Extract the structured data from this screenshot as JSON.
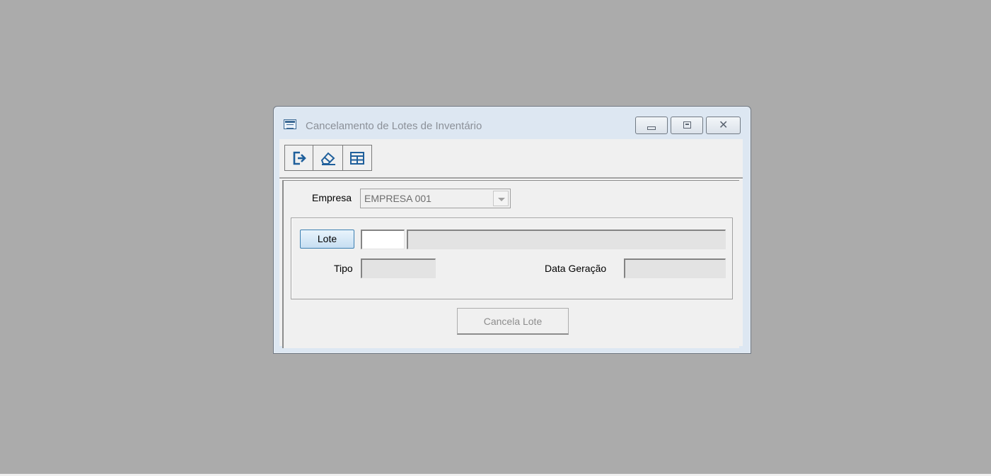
{
  "window": {
    "title": "Cancelamento de Lotes de Inventário"
  },
  "toolbar": {
    "buttons": [
      {
        "name": "exit",
        "icon": "exit-icon"
      },
      {
        "name": "clear",
        "icon": "eraser-icon"
      },
      {
        "name": "grid",
        "icon": "table-icon"
      }
    ]
  },
  "form": {
    "empresa_label": "Empresa",
    "empresa_value": "EMPRESA 001",
    "lote_button": "Lote",
    "lote_code": "",
    "lote_description": "",
    "tipo_label": "Tipo",
    "tipo_value": "",
    "data_label": "Data Geração",
    "data_value": "",
    "cancel_button": "Cancela Lote"
  },
  "colors": {
    "desktop": "#ababab",
    "accent": "#1f5f9b"
  }
}
